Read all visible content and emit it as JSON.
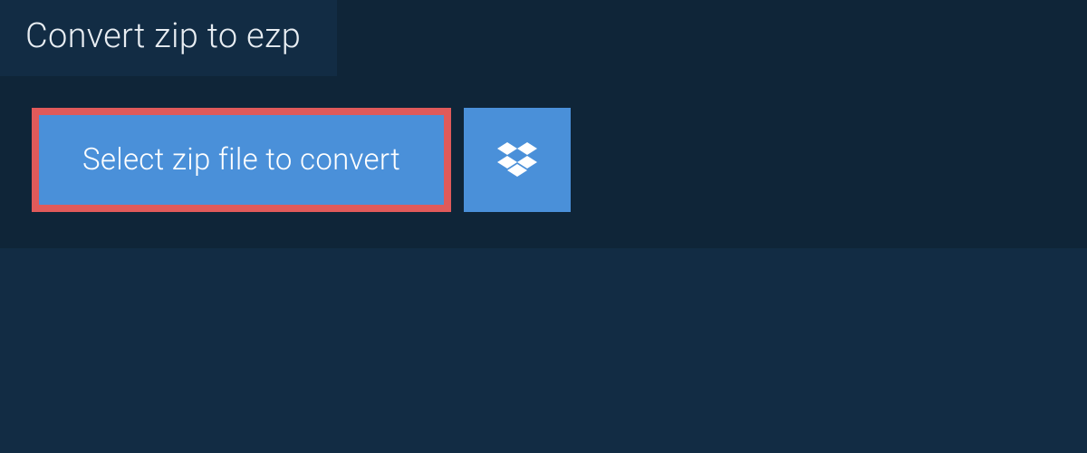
{
  "header": {
    "title": "Convert zip to ezp"
  },
  "actions": {
    "select_label": "Select zip file to convert"
  },
  "colors": {
    "page_bg": "#122c44",
    "panel_bg": "#0f2538",
    "button_bg": "#4a90d9",
    "button_border": "#e05a5a",
    "text_light": "#e8edf2",
    "text_white": "#ffffff"
  }
}
